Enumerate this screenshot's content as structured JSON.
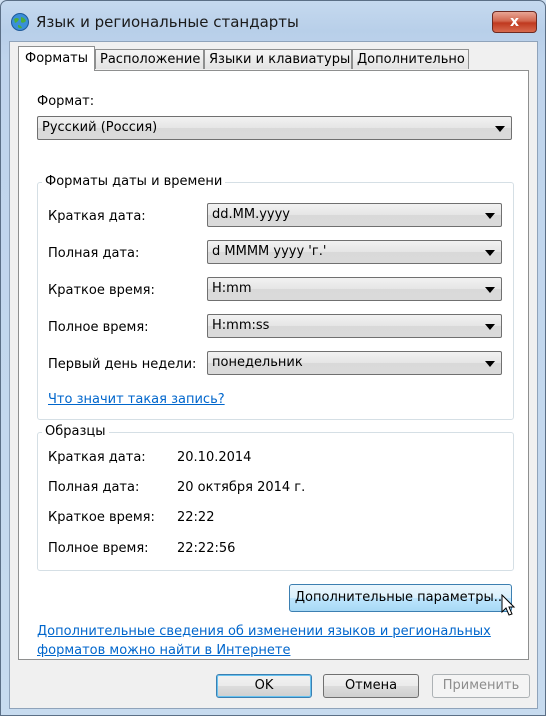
{
  "window": {
    "title": "Язык и региональные стандарты",
    "close_label": "x"
  },
  "tabs": [
    {
      "label": "Форматы",
      "active": true
    },
    {
      "label": "Расположение",
      "active": false
    },
    {
      "label": "Языки и клавиатуры",
      "active": false
    },
    {
      "label": "Дополнительно",
      "active": false
    }
  ],
  "format": {
    "label": "Формат:",
    "value": "Русский (Россия)"
  },
  "datetime": {
    "title": "Форматы даты и времени",
    "rows": [
      {
        "label": "Краткая дата:",
        "value": "dd.MM.yyyy"
      },
      {
        "label": "Полная дата:",
        "value": "d MMMM yyyy 'г.'"
      },
      {
        "label": "Краткое время:",
        "value": "H:mm"
      },
      {
        "label": "Полное время:",
        "value": "H:mm:ss"
      },
      {
        "label": "Первый день недели:",
        "value": "понедельник"
      }
    ],
    "help_link": "Что значит такая запись?"
  },
  "samples": {
    "title": "Образцы",
    "rows": [
      {
        "label": "Краткая дата:",
        "value": "20.10.2014"
      },
      {
        "label": "Полная дата:",
        "value": "20 октября 2014 г."
      },
      {
        "label": "Краткое время:",
        "value": "22:22"
      },
      {
        "label": "Полное время:",
        "value": "22:22:56"
      }
    ]
  },
  "advanced_button": "Дополнительные параметры...",
  "info_link": {
    "line1": "Дополнительные сведения об изменении языков и региональных",
    "line2": "форматов можно найти в Интернете"
  },
  "buttons": {
    "ok": "OK",
    "cancel": "Отмена",
    "apply": "Применить"
  }
}
